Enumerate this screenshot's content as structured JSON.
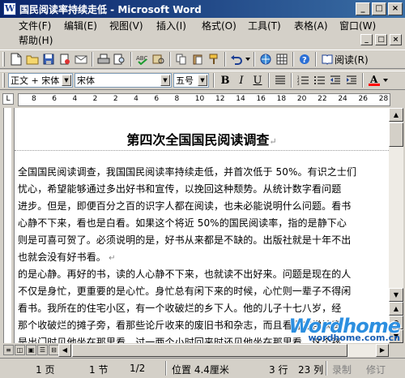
{
  "window": {
    "title": "国民阅读率持续走低 - Microsoft Word",
    "app_icon_letter": "W",
    "controls": {
      "minimize": "_",
      "maximize": "□",
      "close": "×"
    }
  },
  "menu": {
    "items": [
      "文件(F)",
      "编辑(E)",
      "视图(V)",
      "插入(I)",
      "格式(O)",
      "工具(T)",
      "表格(A)",
      "窗口(W)",
      "帮助(H)"
    ],
    "doc_controls": {
      "minimize": "_",
      "restore": "□",
      "close": "×"
    }
  },
  "toolbar_standard": {
    "read_label": "阅读(R)"
  },
  "toolbar_format": {
    "style": "正文 + 宋体",
    "font": "宋体",
    "size": "五号",
    "bold": "B",
    "italic": "I",
    "underline": "U",
    "font_color_glyph": "A",
    "font_color": "#ff0000"
  },
  "ruler": {
    "numbers": [
      "8",
      "6",
      "4",
      "2",
      "2",
      "4",
      "6",
      "8",
      "10",
      "12",
      "14",
      "16",
      "18",
      "20",
      "22",
      "24",
      "26",
      "28"
    ]
  },
  "document": {
    "title": "第四次全国国民阅读调查",
    "lines": [
      "全国国民阅读调查，我国国民阅读率持续走低，并首次低于 50%。有识之士们",
      "忧心，希望能够通过多出好书和宣传，以挽回这种颓势。从统计数字看问题",
      "进步。但是，即便百分之百的识字人都在阅读，也未必能说明什么问题。看书",
      "心静不下来，看也是白看。如果这个将近 50%的国民阅读率，指的是静下心",
      "则是可喜可贺了。必须说明的是，好书从来都是不缺的。出版社就是十年不出",
      "也就会没有好书看。",
      "的是心静。再好的书，读的人心静不下来，也就读不出好来。问题是现在的人",
      "不仅是身忙，更重要的是心忙。身忙总有闲下来的时候，心忙则一辈子不得闲",
      "看书。我所在的住宅小区，有一个收破烂的乡下人。他的儿子十七八岁，经",
      "那个收破烂的摊子旁，看那些论斤收来的废旧书和杂志，而且看得非常认真",
      "是出门时见他坐在那里看，过一两个小时回来时还见他坐在那里看。这个孩"
    ]
  },
  "status": {
    "page": "1 页",
    "section": "1 节",
    "page_of": "1/2",
    "position": "位置 4.4厘米",
    "line": "3 行",
    "column": "23 列",
    "rec": "录制",
    "trk": "修订"
  },
  "watermark": {
    "logo": "Wordhome",
    "url": "wordhome.com.cn"
  }
}
